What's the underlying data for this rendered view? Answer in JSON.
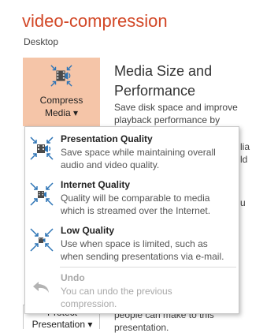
{
  "header": {
    "title": "video-compression",
    "subtitle": "Desktop"
  },
  "compress_button": {
    "line1": "Compress",
    "line2": "Media ▾",
    "icon": "compress-media-icon"
  },
  "media_section": {
    "heading_line1": "Media Size and",
    "heading_line2": "Performance",
    "desc_line1": "Save disk space and improve",
    "desc_line2": "playback performance by"
  },
  "background_fragments": {
    "r1": "lia",
    "r2": "ld",
    "r3": "u",
    "r4": "people can make to this",
    "r5": "presentation."
  },
  "protect_button": {
    "line1": "Protect",
    "line2": "Presentation ▾"
  },
  "menu": {
    "items": [
      {
        "title": "Presentation Quality",
        "desc1": "Save space while maintaining overall",
        "desc2": "audio and video quality.",
        "icon": "presentation-quality-icon"
      },
      {
        "title": "Internet Quality",
        "desc1": "Quality will be comparable to media",
        "desc2": "which is streamed over the Internet.",
        "icon": "internet-quality-icon"
      },
      {
        "title": "Low Quality",
        "desc1": "Use when space is limited, such as",
        "desc2": "when sending presentations via e-mail.",
        "icon": "low-quality-icon"
      },
      {
        "title": "Undo",
        "desc1": "You can undo the previous",
        "desc2": "compression.",
        "icon": "undo-icon",
        "disabled": true
      }
    ]
  },
  "colors": {
    "accent": "#d24726",
    "button_highlight": "#f5c5a8",
    "icon_blue": "#2e75b6"
  }
}
